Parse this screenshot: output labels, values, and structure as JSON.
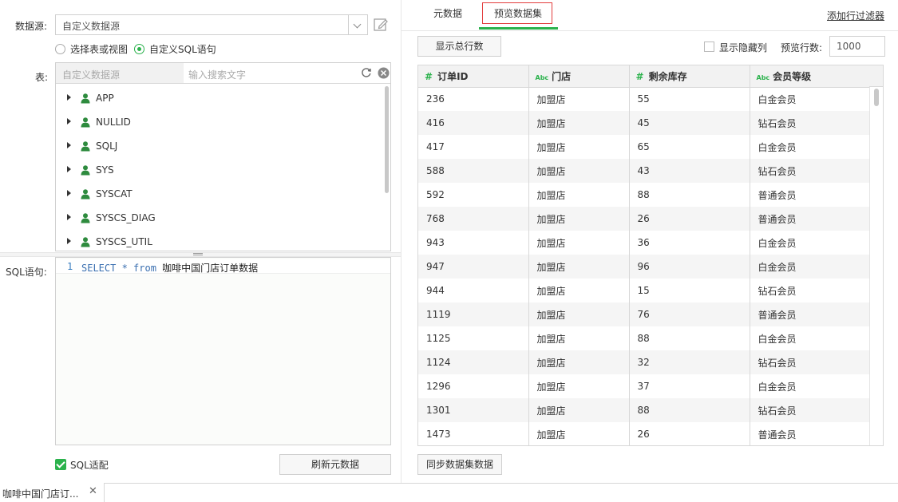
{
  "left": {
    "datasource_label": "数据源:",
    "datasource_value": "自定义数据源",
    "radio_table_label": "选择表或视图",
    "radio_sql_label": "自定义SQL语句",
    "table_label": "表:",
    "table_source": "自定义数据源",
    "search_placeholder": "输入搜索文字",
    "tree_items": [
      "APP",
      "NULLID",
      "SQLJ",
      "SYS",
      "SYSCAT",
      "SYSCS_DIAG",
      "SYSCS_UTIL"
    ],
    "sql_label": "SQL语句:",
    "sql_line_number": "1",
    "sql_keyword_code": "SELECT * from",
    "sql_table_name": "咖啡中国门店订单数据",
    "sql_adapt_label": "SQL适配",
    "refresh_button": "刷新元数据"
  },
  "right": {
    "tabs": [
      "元数据",
      "预览数据集"
    ],
    "active_tab": "预览数据集",
    "add_filter_link": "添加行过滤器",
    "show_total_button": "显示总行数",
    "show_hidden_label": "显示隐藏列",
    "preview_rows_label": "预览行数:",
    "preview_rows_value": "1000",
    "columns": [
      {
        "type": "#",
        "name": "订单ID"
      },
      {
        "type": "Abc",
        "name": "门店"
      },
      {
        "type": "#",
        "name": "剩余库存"
      },
      {
        "type": "Abc",
        "name": "会员等级"
      }
    ],
    "rows": [
      [
        "236",
        "加盟店",
        "55",
        "白金会员"
      ],
      [
        "416",
        "加盟店",
        "45",
        "钻石会员"
      ],
      [
        "417",
        "加盟店",
        "65",
        "白金会员"
      ],
      [
        "588",
        "加盟店",
        "43",
        "钻石会员"
      ],
      [
        "592",
        "加盟店",
        "88",
        "普通会员"
      ],
      [
        "768",
        "加盟店",
        "26",
        "普通会员"
      ],
      [
        "943",
        "加盟店",
        "36",
        "白金会员"
      ],
      [
        "947",
        "加盟店",
        "96",
        "白金会员"
      ],
      [
        "944",
        "加盟店",
        "15",
        "钻石会员"
      ],
      [
        "1119",
        "加盟店",
        "76",
        "普通会员"
      ],
      [
        "1125",
        "加盟店",
        "88",
        "白金会员"
      ],
      [
        "1124",
        "加盟店",
        "32",
        "钻石会员"
      ],
      [
        "1296",
        "加盟店",
        "37",
        "白金会员"
      ],
      [
        "1301",
        "加盟店",
        "88",
        "钻石会员"
      ],
      [
        "1473",
        "加盟店",
        "26",
        "普通会员"
      ]
    ],
    "sync_button": "同步数据集数据"
  },
  "bottom": {
    "tab_label": "咖啡中国门店订...",
    "close_glyph": "✕"
  },
  "colors": {
    "accent": "#2bb24c",
    "active_tab_border": "#e23c3c",
    "user_icon": "#2e8b3e"
  }
}
